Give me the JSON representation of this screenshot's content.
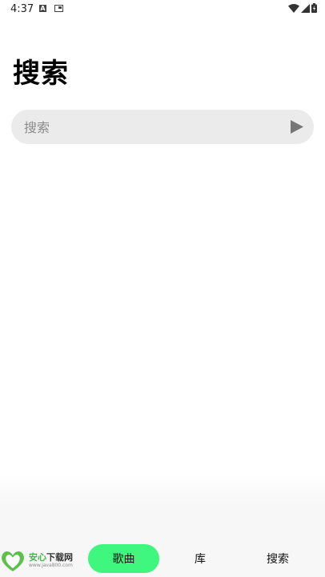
{
  "status_bar": {
    "time": "4:37"
  },
  "page": {
    "title": "搜索"
  },
  "search": {
    "placeholder": "搜索"
  },
  "nav": {
    "items": [
      {
        "label": "歌曲",
        "active": true
      },
      {
        "label": "库",
        "active": false
      },
      {
        "label": "搜索",
        "active": false
      }
    ]
  },
  "watermark": {
    "title_part1": "安心",
    "title_part2": "下载网",
    "url": "www.java800.com"
  },
  "colors": {
    "accent": "#3ff77e",
    "search_bg": "#ebebeb",
    "play_icon": "#777777"
  },
  "icons": [
    "a-notification-icon",
    "card-notification-icon",
    "wifi-icon",
    "signal-icon",
    "battery-icon",
    "send-icon"
  ]
}
